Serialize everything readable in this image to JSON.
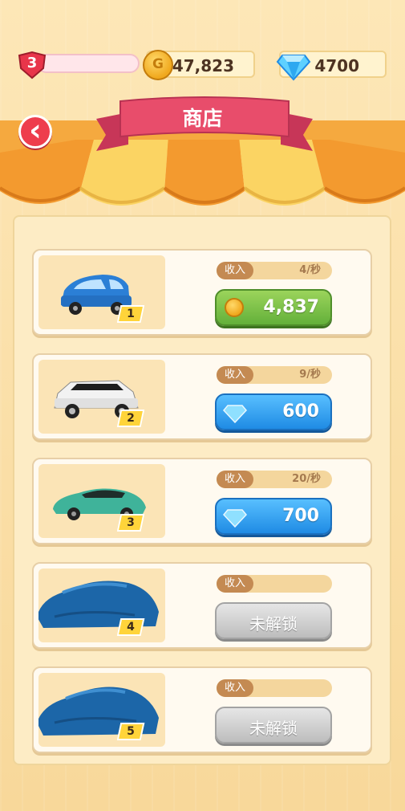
{
  "hud": {
    "level": "3",
    "coins": "47,823",
    "gems": "4700"
  },
  "shop": {
    "title": "商店"
  },
  "cars": [
    {
      "tier": "1",
      "income_label": "收入",
      "income_rate": "4/秒",
      "price": "4,837",
      "currency": "coin",
      "locked": false,
      "color": "#2b7fd6"
    },
    {
      "tier": "2",
      "income_label": "收入",
      "income_rate": "9/秒",
      "price": "600",
      "currency": "gem",
      "locked": false,
      "color": "#f2f2f2"
    },
    {
      "tier": "3",
      "income_label": "收入",
      "income_rate": "20/秒",
      "price": "700",
      "currency": "gem",
      "locked": false,
      "color": "#3fb39a"
    },
    {
      "tier": "4",
      "income_label": "收入",
      "income_rate": "",
      "price": "未解锁",
      "currency": "none",
      "locked": true,
      "color": "#1c66a8"
    },
    {
      "tier": "5",
      "income_label": "收入",
      "income_rate": "",
      "price": "未解锁",
      "currency": "none",
      "locked": true,
      "color": "#1c66a8"
    }
  ],
  "colors": {
    "awning_orange": "#f39a2f",
    "awning_yellow": "#fbd463",
    "banner_pink": "#e84d6b",
    "coin_button": "#63b03a",
    "gem_button": "#1f8be4",
    "locked_button": "#bdbdbd"
  }
}
